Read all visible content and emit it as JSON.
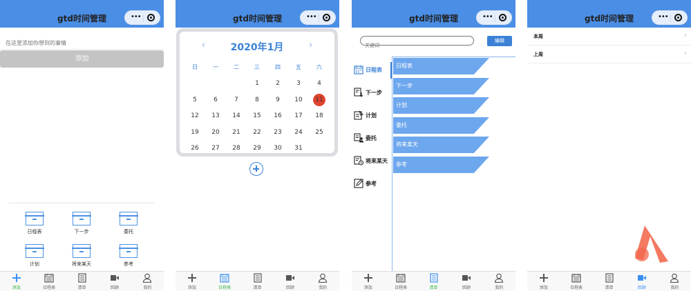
{
  "app": {
    "title": "gtd时间管理"
  },
  "tabbar": {
    "items": [
      {
        "label": "添加",
        "icon": "plus-icon"
      },
      {
        "label": "日程表",
        "icon": "calendar-icon"
      },
      {
        "label": "清单",
        "icon": "list-icon"
      },
      {
        "label": "回顾",
        "icon": "review-icon"
      },
      {
        "label": "我的",
        "icon": "person-icon"
      }
    ]
  },
  "add_screen": {
    "input_placeholder": "在这里添加你想到的事情",
    "add_button": "添加",
    "categories": [
      "日程表",
      "下一步",
      "委托",
      "计划",
      "将来某天",
      "参考"
    ]
  },
  "calendar_screen": {
    "month_label": "2020年1月",
    "prev": "‹",
    "next": "›",
    "weekdays": [
      "日",
      "一",
      "二",
      "三",
      "四",
      "五",
      "六"
    ],
    "weeks": [
      [
        "",
        "",
        "",
        "1",
        "2",
        "3",
        "4"
      ],
      [
        "5",
        "6",
        "7",
        "8",
        "9",
        "10",
        "11"
      ],
      [
        "12",
        "13",
        "14",
        "15",
        "16",
        "17",
        "18"
      ],
      [
        "19",
        "20",
        "21",
        "22",
        "23",
        "24",
        "25"
      ],
      [
        "26",
        "27",
        "28",
        "29",
        "30",
        "31",
        ""
      ]
    ],
    "today": "11"
  },
  "list_screen": {
    "search_placeholder": "关键词",
    "edit_button": "编辑",
    "sidebar": [
      "日程表",
      "下一步",
      "计划",
      "委托",
      "将来某天",
      "参考"
    ],
    "items": [
      "日程表",
      "下一步",
      "计划",
      "委托",
      "将来某天",
      "参考"
    ]
  },
  "review_screen": {
    "rows": [
      "本周",
      "上周"
    ]
  },
  "colors": {
    "navbar": "#4a8ee6",
    "accent_blue": "#3b82d6",
    "list_item": "#6da7ee",
    "today": "#e0442e",
    "tab_active_green": "#3bb34a",
    "logo": "#f26a50"
  }
}
